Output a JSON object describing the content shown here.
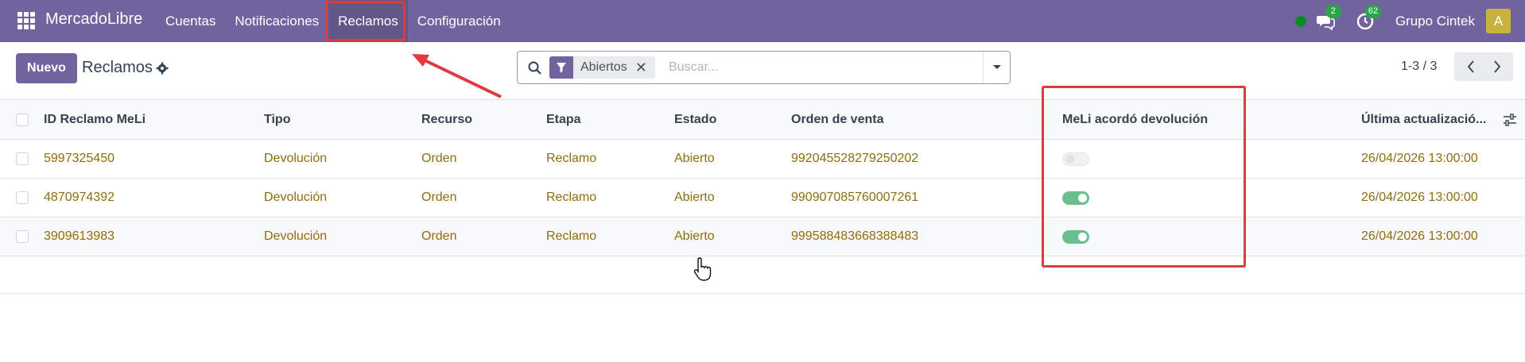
{
  "navbar": {
    "brand": "MercadoLibre",
    "menu": [
      "Cuentas",
      "Notificaciones",
      "Reclamos",
      "Configuración"
    ],
    "active_menu": "Reclamos",
    "messages_badge": "2",
    "activities_badge": "62",
    "company": "Grupo Cintek",
    "avatar_letter": "A",
    "status_color": "#0f8a2a"
  },
  "control": {
    "new_label": "Nuevo",
    "title": "Reclamos",
    "search": {
      "facet_label": "Abiertos",
      "facet_close": "✕",
      "placeholder": "Buscar..."
    },
    "pager": "1-3 / 3"
  },
  "table": {
    "columns": [
      "ID Reclamo MeLi",
      "Tipo",
      "Recurso",
      "Etapa",
      "Estado",
      "Orden de venta",
      "MeLi acordó devolución",
      "Última actualizació..."
    ],
    "rows": [
      {
        "id": "5997325450",
        "tipo": "Devolución",
        "recurso": "Orden",
        "etapa": "Reclamo",
        "estado": "Abierto",
        "orden": "992045528279250202",
        "devolucion": false,
        "actualizacion": "26/04/2026 13:00:00"
      },
      {
        "id": "4870974392",
        "tipo": "Devolución",
        "recurso": "Orden",
        "etapa": "Reclamo",
        "estado": "Abierto",
        "orden": "990907085760007261",
        "devolucion": true,
        "actualizacion": "26/04/2026 13:00:00"
      },
      {
        "id": "3909613983",
        "tipo": "Devolución",
        "recurso": "Orden",
        "etapa": "Reclamo",
        "estado": "Abierto",
        "orden": "999588483668388483",
        "devolucion": true,
        "actualizacion": "26/04/2026 13:00:00"
      }
    ]
  },
  "colors": {
    "brand": "#71639e",
    "link": "#8f6d0e",
    "toggle_on": "#6abf8f",
    "annotation": "#e0393e"
  }
}
